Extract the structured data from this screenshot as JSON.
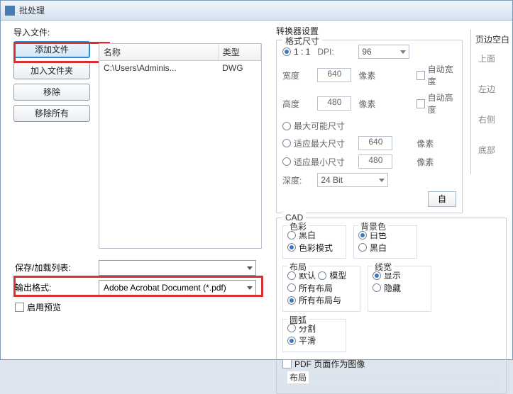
{
  "window": {
    "title": "批处理"
  },
  "left": {
    "import_label": "导入文件:",
    "buttons": {
      "add_file": "添加文件",
      "add_folder": "加入文件夹",
      "remove": "移除",
      "remove_all": "移除所有"
    },
    "table": {
      "headers": {
        "name": "名称",
        "type": "类型"
      },
      "rows": [
        {
          "name": "C:\\Users\\Adminis...",
          "type": "DWG"
        }
      ]
    },
    "save_list_label": "保存/加载列表:",
    "output_format_label": "输出格式:",
    "output_format_value": "Adobe Acrobat Document (*.pdf)",
    "enable_preview": "启用预览"
  },
  "converter": {
    "title": "转换器设置",
    "format_size": {
      "title": "格式尺寸",
      "ratio_11": "1 : 1",
      "dpi_label": "DPI:",
      "dpi_value": "96",
      "width_label": "宽度",
      "width_value": "640",
      "px": "像素",
      "auto_w": "自动宽度",
      "height_label": "高度",
      "height_value": "480",
      "auto_h": "自动高度",
      "max_possible": "最大可能尺寸",
      "fit_max": "适应最大尺寸",
      "fit_max_val": "640",
      "fit_min": "适应最小尺寸",
      "fit_min_val": "480",
      "depth_label": "深度:",
      "depth_value": "24 Bit",
      "auto_btn": "自"
    },
    "cad": {
      "title": "CAD",
      "color": {
        "title": "色彩",
        "bw": "黑白",
        "color_mode": "色彩模式"
      },
      "bg": {
        "title": "背景色",
        "white": "白色",
        "black": "黑白"
      },
      "layout": {
        "title": "布局",
        "default": "默认",
        "model": "模型",
        "all": "所有布局",
        "all_with": "所有布局与"
      },
      "lineweight": {
        "title": "线宽",
        "show": "显示",
        "hide": "隐藏"
      },
      "arc": {
        "title": "圆弧",
        "split": "分割",
        "smooth": "平滑"
      },
      "pdf_as_image": "PDF 页面作为图像",
      "layout2": "布局"
    },
    "margins": {
      "title": "页边空白",
      "top": "上面",
      "left": "左边",
      "right": "右侧",
      "bottom": "底部"
    }
  }
}
